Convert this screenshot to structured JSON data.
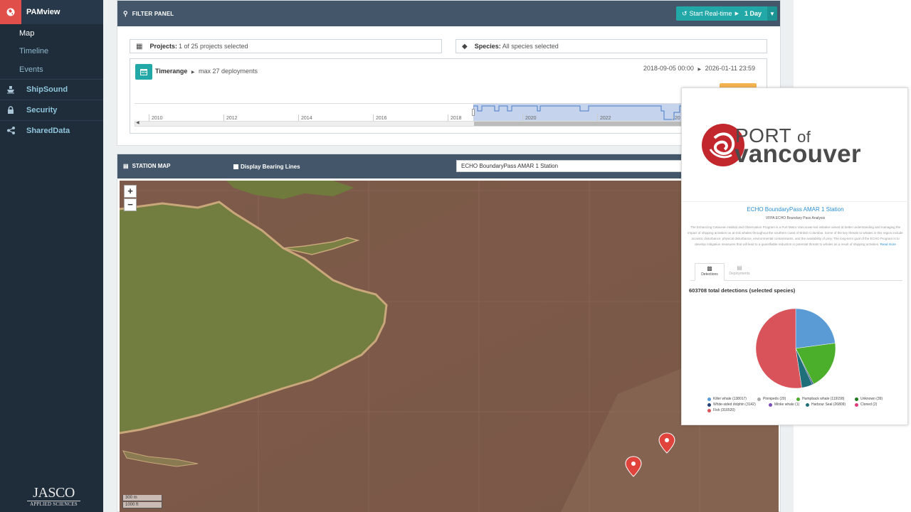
{
  "sidebar": {
    "app_label": "PAMview",
    "subitems": [
      "Map",
      "Timeline",
      "Events"
    ],
    "items": [
      {
        "label": "ShipSound",
        "icon": "ship-icon"
      },
      {
        "label": "Security",
        "icon": "lock-icon"
      },
      {
        "label": "SharedData",
        "icon": "share-icon"
      }
    ],
    "logo_line1": "JASCO",
    "logo_line2": "APPLIED SCIENCES"
  },
  "filter_panel": {
    "title": "FILTER PANEL",
    "realtime_label": "Start Real-time",
    "realtime_period": "1 Day",
    "projects_label": "Projects:",
    "projects_value": "1 of 25 projects selected",
    "species_label": "Species:",
    "species_value": "All species selected",
    "timerange_label": "Timerange",
    "timerange_detail": "max 27 deployments",
    "range_start": "2018-09-05 00:00",
    "range_end": "2026-01-11 23:59",
    "timeline_years": [
      "2010",
      "2012",
      "2014",
      "2016",
      "2018",
      "2020",
      "2022",
      "20"
    ]
  },
  "station_map": {
    "title": "STATION MAP",
    "bearing_label": "Display Bearing Lines",
    "station_selected": "ECHO BoundaryPass AMAR 1 Station",
    "zoom_in": "+",
    "zoom_out": "−",
    "scale_m": "300 m",
    "scale_ft": "1000 ft"
  },
  "popup": {
    "logo_word1": "PORT",
    "logo_word_of": "of",
    "logo_word2": "vancouver",
    "station_title": "ECHO BoundaryPass AMAR 1 Station",
    "station_sub": "VFPA ECHO Boundary Pass Analysis",
    "description": "The Enhancing Cetacean Habitat and Observation Program is a Port Metro Vancouver-led initiative aimed at better understanding and managing the impact of shipping activities on at-risk whales throughout the southern coast of British Columbia. Some of the key threats to whales in this region include acoustic disturbance, physical disturbance, environmental contaminants, and the availability of prey. The long-term goal of the ECHO Program is to develop mitigation measures that will lead to a quantifiable reduction in potential threats to whales as a result of shipping activities.",
    "read_more": "Read more",
    "tab_detections": "Detections",
    "tab_deployments": "Deployments",
    "total_text": "603708 total detections (selected species)"
  },
  "chart_data": {
    "type": "pie",
    "series": [
      {
        "name": "Killer whale (138017)",
        "value": 138017,
        "color": "#5b9bd5"
      },
      {
        "name": "Pinnipeds (20)",
        "value": 20,
        "color": "#aaaaaa"
      },
      {
        "name": "Humpback whale (119158)",
        "value": 119158,
        "color": "#4caf2c"
      },
      {
        "name": "Unknown (39)",
        "value": 39,
        "color": "#1e7a1e"
      },
      {
        "name": "White-sided dolphin (3142)",
        "value": 3142,
        "color": "#26407a"
      },
      {
        "name": "Minke whale (1)",
        "value": 1,
        "color": "#7a4fb8"
      },
      {
        "name": "Harbour Seal (26809)",
        "value": 26809,
        "color": "#1f6f7a"
      },
      {
        "name": "Cloned (2)",
        "value": 2,
        "color": "#e03a7a"
      },
      {
        "name": "Fish (316520)",
        "value": 316520,
        "color": "#d9545a"
      }
    ]
  },
  "colors": {
    "sidebar_bg": "#1f2d3a",
    "panel_header": "#44576a",
    "accent_teal": "#23a8a8",
    "brand_red": "#e14f4a"
  }
}
